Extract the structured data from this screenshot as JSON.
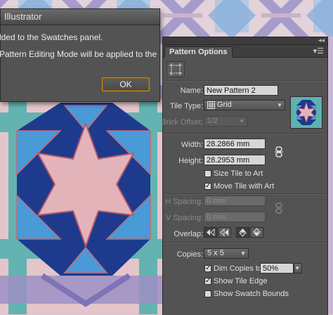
{
  "dialog": {
    "title": "Illustrator",
    "line1": "lded to the Swatches panel.",
    "line2": "Pattern Editing Mode will be applied to the",
    "ok_label": "OK"
  },
  "panel": {
    "tab_label": "Pattern Options",
    "collapse_glyph": "◂◂",
    "menu_glyph": "▾☰",
    "name_label": "Name:",
    "name_value": "New Pattern 2",
    "tile_type_label": "Tile Type:",
    "tile_type_value": "Grid",
    "brick_offset_label": "Brick Offset:",
    "brick_offset_value": "1/2",
    "width_label": "Width:",
    "width_value": "28.2866 mm",
    "height_label": "Height:",
    "height_value": "28.2953 mm",
    "size_tile_to_art_label": "Size Tile to Art",
    "size_tile_to_art_checked": false,
    "move_tile_with_art_label": "Move Tile with Art",
    "move_tile_with_art_checked": true,
    "h_spacing_label": "H Spacing:",
    "h_spacing_value": "0 mm",
    "v_spacing_label": "V Spacing:",
    "v_spacing_value": "0 mm",
    "overlap_label": "Overlap:",
    "copies_label": "Copies:",
    "copies_value": "5 x 5",
    "dim_copies_label": "Dim Copies to:",
    "dim_copies_checked": true,
    "dim_copies_value": "50%",
    "show_tile_edge_label": "Show Tile Edge",
    "show_tile_edge_checked": true,
    "show_swatch_bounds_label": "Show Swatch Bounds",
    "show_swatch_bounds_checked": false,
    "check_glyph": "✓"
  },
  "colors": {
    "pattern_navy": "#1f3a8a",
    "pattern_blue": "#4b9ad6",
    "pattern_teal": "#5bb3b0",
    "pattern_pink": "#e3b9bf",
    "pattern_lavender": "#9a8fc1",
    "panel_bg": "#535353",
    "ok_focus": "#cc8a1a"
  }
}
